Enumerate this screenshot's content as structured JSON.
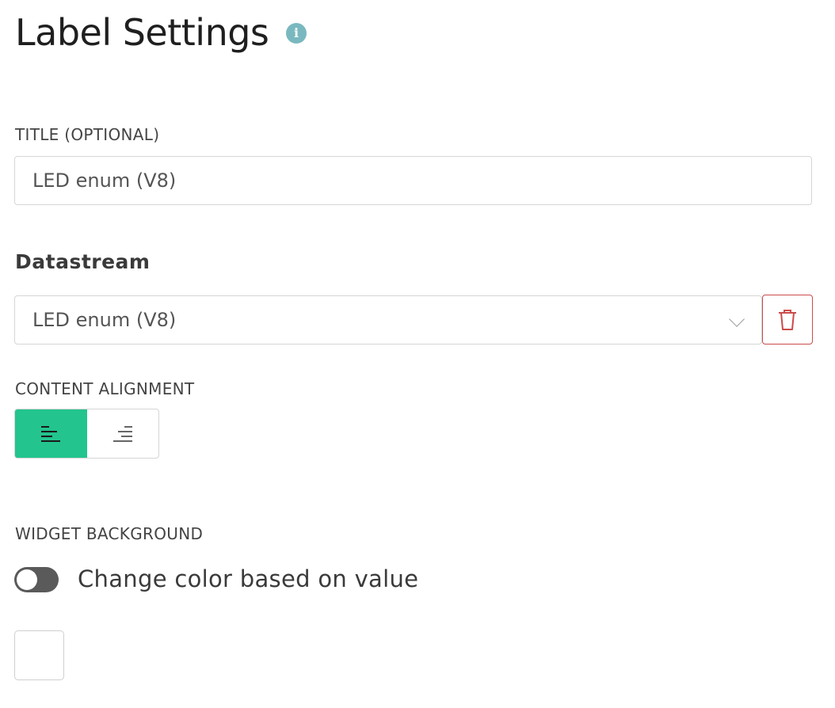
{
  "header": {
    "title": "Label Settings",
    "info_icon": "info-icon",
    "info_glyph": "i"
  },
  "title_section": {
    "label": "TITLE (OPTIONAL)",
    "value": "LED enum (V8)"
  },
  "datastream": {
    "heading": "Datastream",
    "selected": "LED enum (V8)",
    "dropdown_icon": "chevron-down-icon",
    "delete_icon": "trash-icon"
  },
  "alignment": {
    "label": "CONTENT ALIGNMENT",
    "options": [
      "align-left-icon",
      "align-right-icon"
    ],
    "active": "align-left-icon",
    "active_color": "#23c48e"
  },
  "background": {
    "label": "WIDGET BACKGROUND",
    "toggle_label": "Change color based on value",
    "toggle_on": false,
    "swatch_color": "#ffffff"
  },
  "colors": {
    "accent": "#23c48e",
    "danger": "#cc4b4b",
    "info": "#7ab8bf"
  }
}
